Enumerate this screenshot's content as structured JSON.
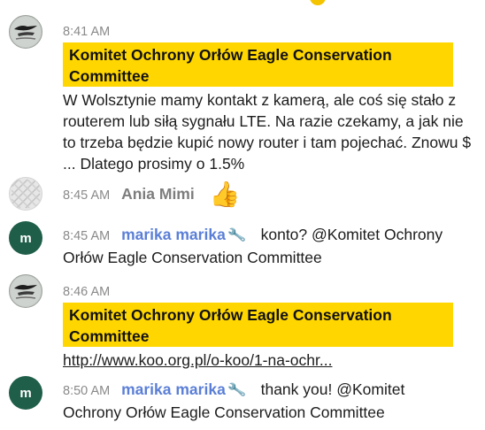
{
  "messages": [
    {
      "time": "8:41 AM",
      "banner": "Komitet Ochrony Orłów Eagle Conservation Committee",
      "text": "W Wolsztynie mamy kontakt z kamerą, ale coś się stało z routerem lub siłą sygnału LTE. Na razie czekamy, a jak nie to trzeba będzie kupić nowy router i tam pojechać. Znowu $ ... Dlatego prosimy o 1.5%",
      "avatar_icon": "eagle-logo-icon"
    },
    {
      "time": "8:45 AM",
      "username": "Ania Mimi",
      "reaction": "👍",
      "avatar_icon": "pattern-avatar-icon"
    },
    {
      "time": "8:45 AM",
      "username": "marika marika",
      "avatar_letter": "m",
      "text_first": "konto? @Komitet Ochrony",
      "text_rest": "Orłów Eagle Conservation Committee"
    },
    {
      "time": "8:46 AM",
      "banner": "Komitet Ochrony Orłów Eagle Conservation Committee",
      "link": "http://www.koo.org.pl/o-koo/1-na-ochr...",
      "avatar_icon": "eagle-logo-icon"
    },
    {
      "time": "8:50 AM",
      "username": "marika marika",
      "avatar_letter": "m",
      "text_first": "thank you! @Komitet",
      "text_rest": "Ochrony Orłów Eagle Conservation Committee"
    }
  ],
  "colors": {
    "banner_bg": "#ffd600",
    "username_blue": "#5b7fd6",
    "avatar_green": "#1f5e49",
    "time_gray": "#8a8a8a"
  }
}
